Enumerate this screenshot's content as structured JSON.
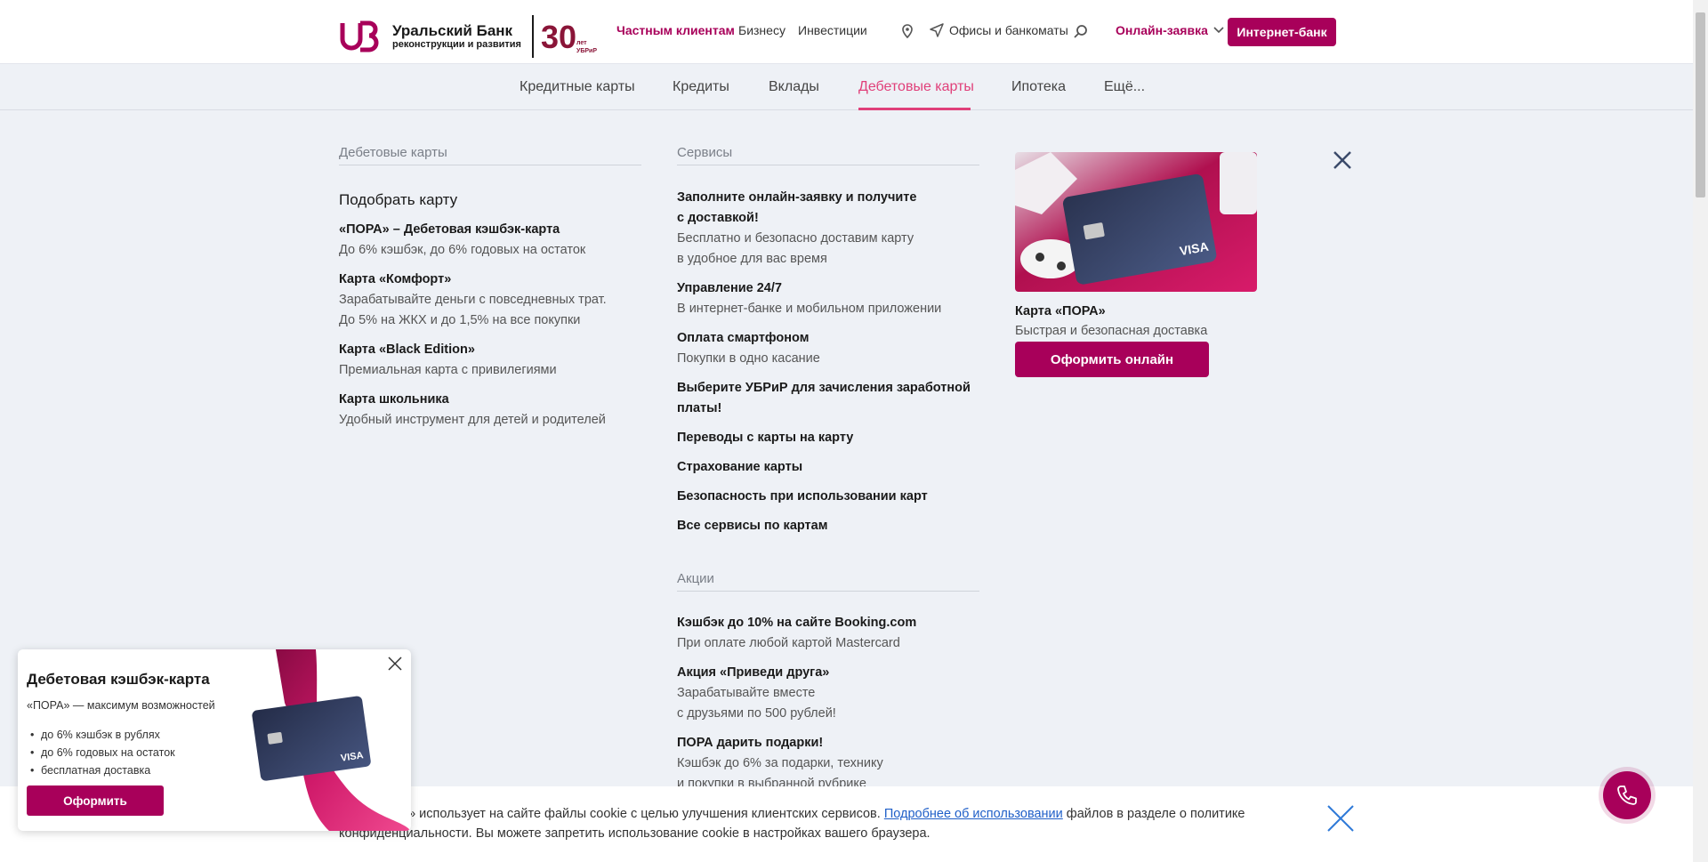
{
  "header": {
    "logo": {
      "name": "Уральский Банк",
      "sub": "реконструкции и развития",
      "anniversary": "30 лет УБРиР"
    },
    "nav": [
      {
        "label": "Частным клиентам"
      },
      {
        "label": "Бизнесу"
      },
      {
        "label": "Инвестиции"
      }
    ],
    "offices_label": "Офисы и банкоматы",
    "online_app_label": "Онлайн-заявка",
    "ibank_label": "Интернет-банк"
  },
  "subnav": {
    "items": [
      {
        "label": "Кредитные карты"
      },
      {
        "label": "Кредиты"
      },
      {
        "label": "Вклады"
      },
      {
        "label": "Дебетовые карты"
      },
      {
        "label": "Ипотека"
      },
      {
        "label": "Ещё..."
      }
    ],
    "active": "Дебетовые карты"
  },
  "menu": {
    "debit": {
      "title": "Дебетовые карты",
      "heading": "Подобрать карту",
      "items": [
        {
          "title": "«ПОРА» – Дебетовая кэшбэк-карта",
          "desc": [
            "До 6% кэшбэк, до 6% годовых на остаток"
          ]
        },
        {
          "title": "Карта «Комфорт»",
          "desc": [
            "Зарабатывайте деньги с повседневных трат.",
            "До 5% на ЖКХ и до 1,5% на все покупки"
          ]
        },
        {
          "title": "Карта «Black Edition»",
          "desc": [
            "Премиальная карта с привилегиями"
          ]
        },
        {
          "title": "Карта школьника",
          "desc": [
            "Удобный инструмент для детей и родителей"
          ]
        }
      ]
    },
    "services": {
      "title": "Сервисы",
      "items": [
        {
          "title": [
            "Заполните онлайн-заявку и получите",
            "с доставкой!"
          ],
          "desc": [
            "Бесплатно и безопасно доставим карту",
            "в удобное для вас время"
          ]
        },
        {
          "title": [
            "Управление 24/7"
          ],
          "desc": [
            "В интернет-банке и мобильном приложении"
          ]
        },
        {
          "title": [
            "Оплата смартфоном"
          ],
          "desc": [
            "Покупки в одно касание"
          ]
        },
        {
          "title": [
            "Выберите УБРиР для зачисления заработной",
            "платы!"
          ],
          "desc": []
        },
        {
          "title": [
            "Переводы с карты на карту"
          ],
          "desc": []
        },
        {
          "title": [
            "Страхование карты"
          ],
          "desc": []
        },
        {
          "title": [
            "Безопасность при использовании карт"
          ],
          "desc": []
        },
        {
          "title": [
            "Все сервисы по картам"
          ],
          "desc": []
        }
      ]
    },
    "promos": {
      "title": "Акции",
      "items": [
        {
          "title": "Кэшбэк до 10% на сайте Booking.com",
          "desc": [
            "При оплате любой картой Mastercard"
          ]
        },
        {
          "title": "Акция «Приведи друга»",
          "desc": [
            "Зарабатывайте вместе",
            "с друзьями по 500 рублей!"
          ]
        },
        {
          "title": "ПОРА дарить подарки!",
          "desc": [
            "Кэшбэк до 6% за подарки, технику",
            "и покупки в выбранной рубрике"
          ]
        }
      ]
    },
    "card_promo": {
      "title": "Карта «ПОРА»",
      "desc": "Быстрая и безопасная доставка",
      "button": "Оформить онлайн"
    }
  },
  "cookie": {
    "text_before": "АО «УБРиР» использует на сайте файлы cookie с целью улучшения клиентских сервисов. ",
    "link": "Подробнее об использовании",
    "text_after": " файлов в разделе о политике конфиденциальности. Вы можете запретить использование cookie в настройках вашего браузера."
  },
  "popup": {
    "title": "Дебетовая кэшбэк-карта",
    "subtitle": "«ПОРА» — максимум возможностей",
    "bullets": [
      "до 6% кэшбэк в рублях",
      "до 6% годовых на остаток",
      "бесплатная доставка"
    ],
    "button": "Оформить"
  },
  "colors": {
    "brand": "#a8005a",
    "accent": "#e0407a",
    "bg": "#eef1f6"
  }
}
